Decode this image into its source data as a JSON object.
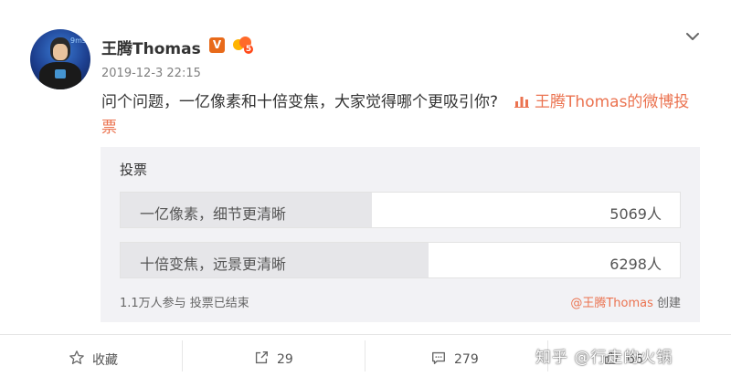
{
  "post": {
    "username": "王腾Thomas",
    "verified_badge": "V",
    "level_badge": "5",
    "timestamp": "2019-12-3 22:15",
    "text": "问个问题，一亿像素和十倍变焦，大家觉得哪个更吸引你?",
    "poll_link_text": "王腾Thomas的微博投票"
  },
  "poll": {
    "title": "投票",
    "options": [
      {
        "label": "一亿像素，细节更清晰",
        "count": "5069人",
        "share": 0.45
      },
      {
        "label": "十倍变焦，远景更清晰",
        "count": "6298人",
        "share": 0.55
      }
    ],
    "footer_left": "1.1万人参与 投票已结束",
    "creator": "@王腾Thomas",
    "creator_suffix": " 创建"
  },
  "actions": {
    "favorite_label": "收藏",
    "repost_count": "29",
    "comment_count": "279",
    "like_count": "66"
  },
  "watermark": "知乎 @行走的火锅",
  "colors": {
    "link": "#eb7350",
    "poll_bg": "#f2f2f5",
    "verified": "#e86a1a"
  }
}
